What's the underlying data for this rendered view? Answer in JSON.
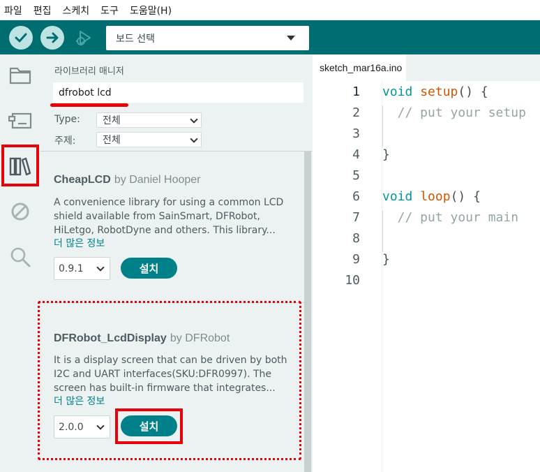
{
  "menu": [
    "파일",
    "편집",
    "스케치",
    "도구",
    "도움말(H)"
  ],
  "toolbar": {
    "verify_icon": "checkmark-icon",
    "upload_icon": "arrow-right-icon",
    "debug_icon": "debug-icon",
    "board_select": "보드 선택"
  },
  "sidebar": {
    "items": [
      {
        "icon": "folder-icon"
      },
      {
        "icon": "board-manager-icon"
      },
      {
        "icon": "library-icon"
      },
      {
        "icon": "debug-disabled-icon"
      },
      {
        "icon": "search-icon"
      }
    ]
  },
  "library": {
    "title": "라이브러리 매니저",
    "search_value": "dfrobot lcd",
    "type_label": "Type:",
    "type_value": "전체",
    "topic_label": "주제:",
    "topic_value": "전체",
    "results": [
      {
        "name": "CheapLCD",
        "by": "by Daniel Hooper",
        "desc": [
          "A convenience library for using a common LCD",
          "shield available from SainSmart, DFRobot,",
          "HiLetgo, RobotDyne and others. This library..."
        ],
        "more": "더 많은 정보",
        "version": "0.9.1",
        "install": "설치"
      },
      {
        "name": "DFRobot_LcdDisplay",
        "by": "by DFRobot",
        "desc": [
          "It is a display screen that can be driven by both",
          "I2C and UART interfaces(SKU:DFR0997). The",
          "screen has built-in firmware that integrates..."
        ],
        "more": "더 많은 정보",
        "version": "2.0.0",
        "install": "설치"
      }
    ]
  },
  "editor": {
    "tab": "sketch_mar16a.ino",
    "line_numbers": [
      "1",
      "2",
      "3",
      "4",
      "5",
      "6",
      "7",
      "8",
      "9",
      "10"
    ],
    "code": {
      "l1_kw": "void",
      "l1_fn": "setup",
      "l1_rest": "() {",
      "l2": "  // put your setup",
      "l4": "}",
      "l6_kw": "void",
      "l6_fn": "loop",
      "l6_rest": "() {",
      "l7": "  // put your main",
      "l9": "}"
    }
  },
  "colors": {
    "accent": "#006d70",
    "install_button": "#00818a",
    "highlight": "#e8000b"
  }
}
